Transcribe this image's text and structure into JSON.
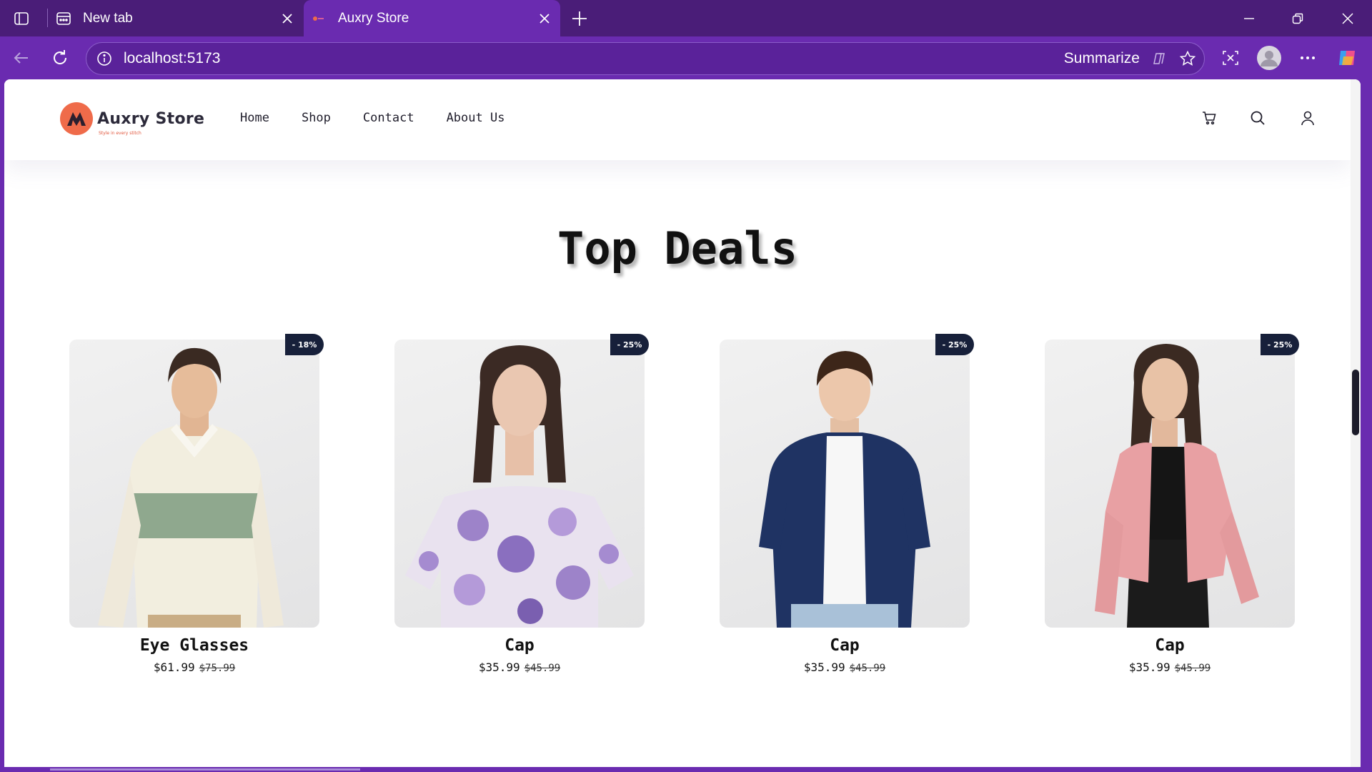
{
  "browser": {
    "tabs": [
      {
        "title": "New tab",
        "active": false
      },
      {
        "title": "Auxry Store",
        "active": true
      }
    ],
    "url": "localhost:5173",
    "summarize_label": "Summarize"
  },
  "site": {
    "brand": "Auxry Store",
    "tagline": "Style in every stitch",
    "nav": [
      "Home",
      "Shop",
      "Contact",
      "About Us"
    ]
  },
  "section": {
    "title": "Top Deals"
  },
  "products": [
    {
      "name": "Eye Glasses",
      "price": "$61.99",
      "old_price": "$75.99",
      "discount": "- 18%"
    },
    {
      "name": "Cap",
      "price": "$35.99",
      "old_price": "$45.99",
      "discount": "- 25%"
    },
    {
      "name": "Cap",
      "price": "$35.99",
      "old_price": "$45.99",
      "discount": "- 25%"
    },
    {
      "name": "Cap",
      "price": "$35.99",
      "old_price": "$45.99",
      "discount": "- 25%"
    }
  ],
  "colors": {
    "browser_accent": "#6a2bb0",
    "brand": "#ef6b4a",
    "badge": "#17203a"
  }
}
